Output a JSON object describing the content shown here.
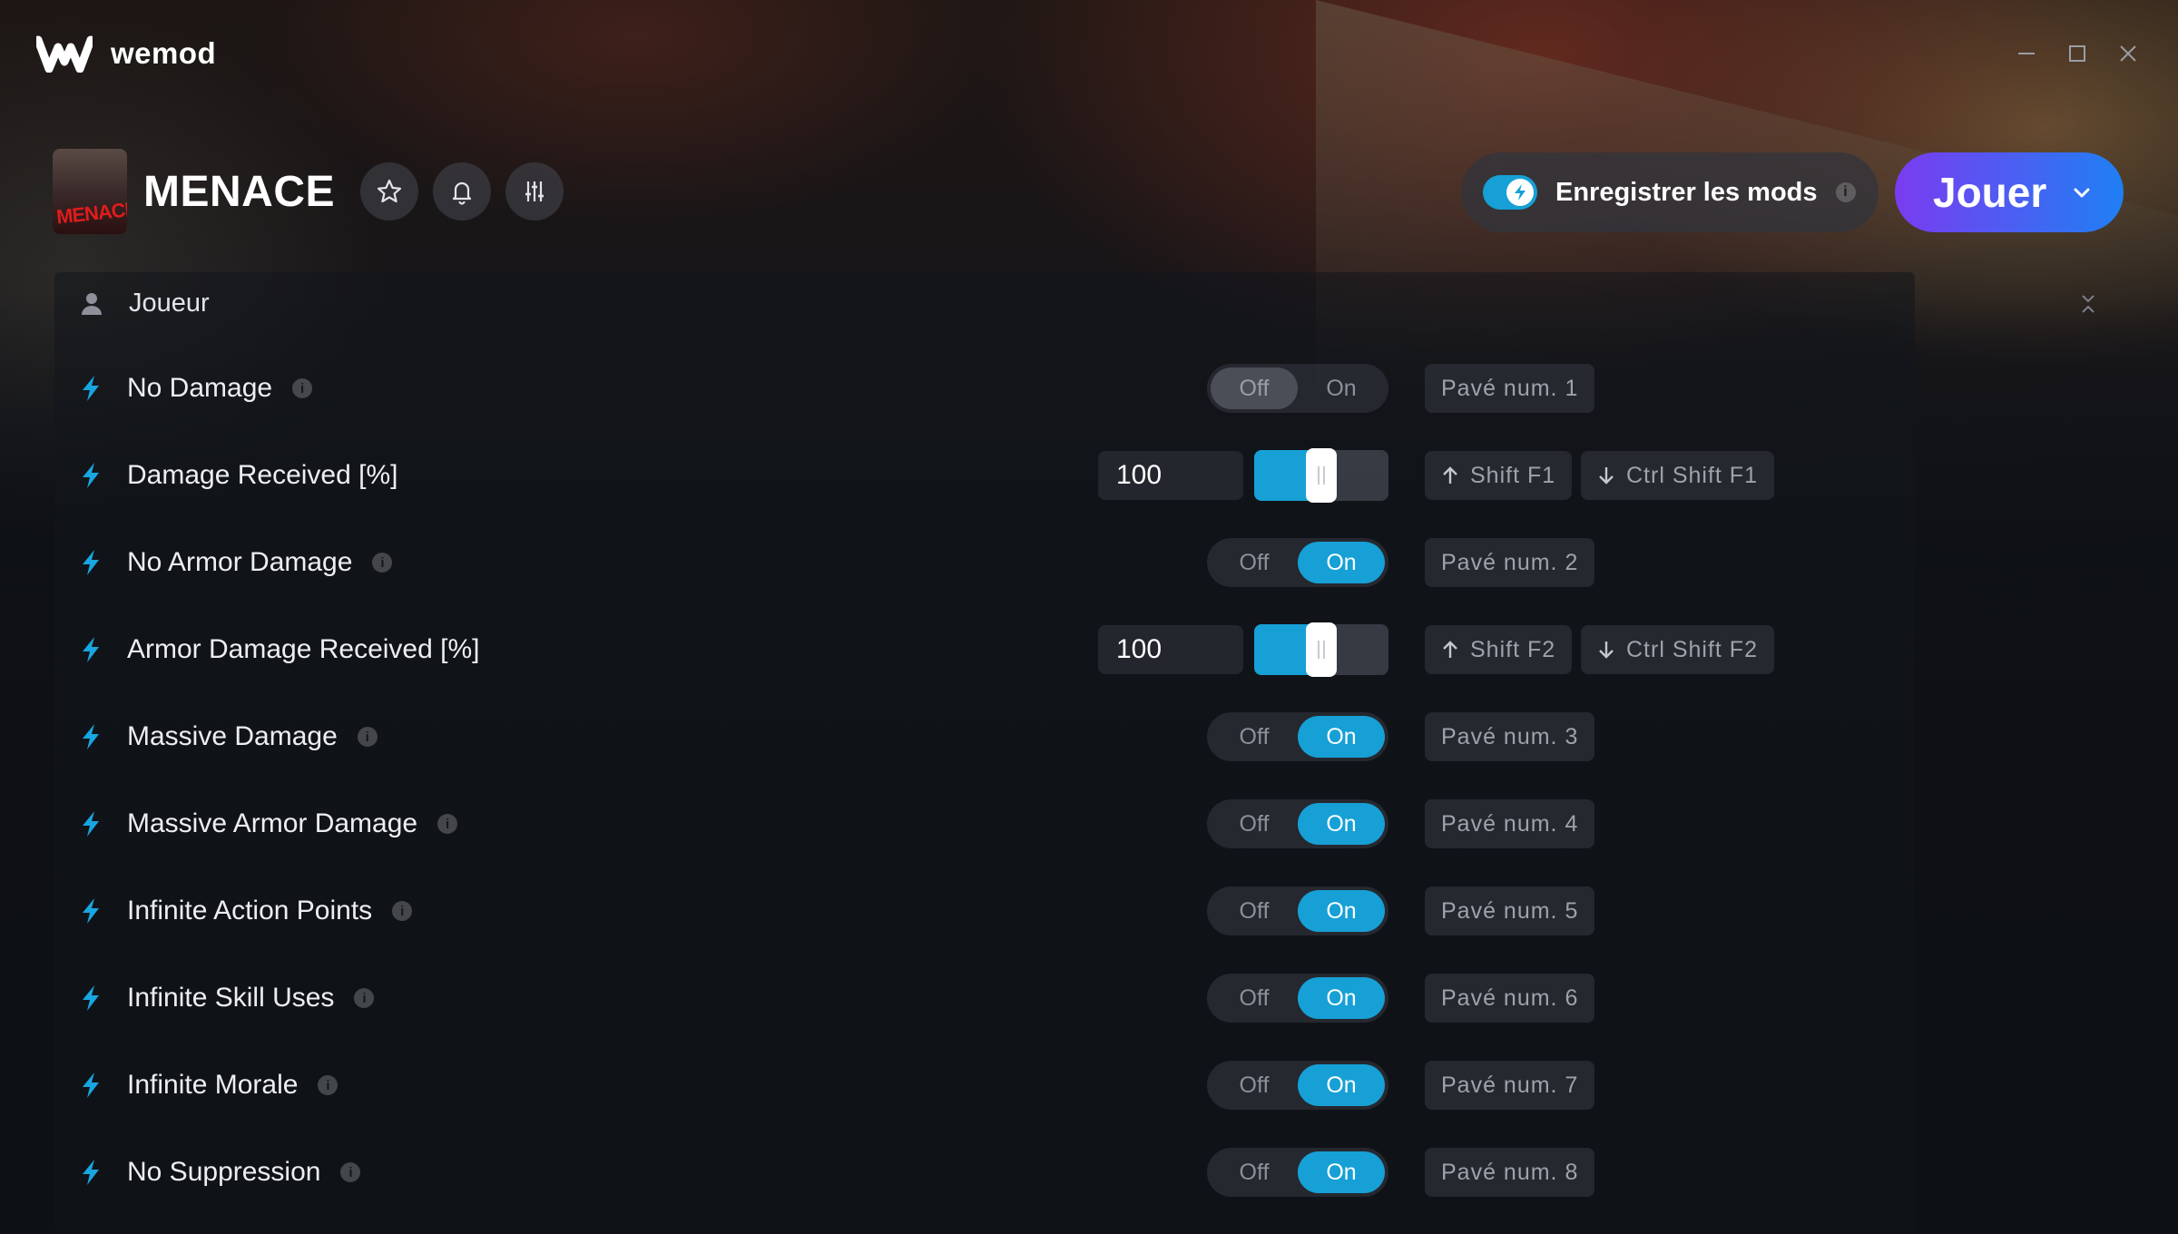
{
  "app": {
    "name": "wemod"
  },
  "game": {
    "title": "MENACE",
    "cover_text": "MENACE"
  },
  "header": {
    "save_mods_label": "Enregistrer les mods",
    "save_mods_info": "i",
    "play_label": "Jouer"
  },
  "section": {
    "title": "Joueur"
  },
  "toggle_labels": {
    "off": "Off",
    "on": "On"
  },
  "mods": [
    {
      "label": "No Damage",
      "info": "i",
      "type": "toggle",
      "state": "off",
      "hotkeys": [
        "Pavé num. 1"
      ]
    },
    {
      "label": "Damage Received [%]",
      "type": "slider",
      "value": "100",
      "level_percent": 50,
      "hotkeys": [
        "Shift F1",
        "Ctrl Shift F1"
      ]
    },
    {
      "label": "No Armor Damage",
      "info": "i",
      "type": "toggle",
      "state": "on",
      "hotkeys": [
        "Pavé num. 2"
      ]
    },
    {
      "label": "Armor Damage Received [%]",
      "type": "slider",
      "value": "100",
      "level_percent": 50,
      "hotkeys": [
        "Shift F2",
        "Ctrl Shift F2"
      ]
    },
    {
      "label": "Massive Damage",
      "info": "i",
      "type": "toggle",
      "state": "on",
      "hotkeys": [
        "Pavé num. 3"
      ]
    },
    {
      "label": "Massive Armor Damage",
      "info": "i",
      "type": "toggle",
      "state": "on",
      "hotkeys": [
        "Pavé num. 4"
      ]
    },
    {
      "label": "Infinite Action Points",
      "info": "i",
      "type": "toggle",
      "state": "on",
      "hotkeys": [
        "Pavé num. 5"
      ]
    },
    {
      "label": "Infinite Skill Uses",
      "info": "i",
      "type": "toggle",
      "state": "on",
      "hotkeys": [
        "Pavé num. 6"
      ]
    },
    {
      "label": "Infinite Morale",
      "info": "i",
      "type": "toggle",
      "state": "on",
      "hotkeys": [
        "Pavé num. 7"
      ]
    },
    {
      "label": "No Suppression",
      "info": "i",
      "type": "toggle",
      "state": "on",
      "hotkeys": [
        "Pavé num. 8"
      ]
    }
  ],
  "colors": {
    "accent": "#16a0d6",
    "play_gradient_start": "#7a3cf0",
    "play_gradient_end": "#1f7ff4",
    "background": "#101217"
  },
  "icons": {
    "favorite": "star-icon",
    "notifications": "bell-icon",
    "settings": "sliders-icon",
    "mod": "bolt-icon",
    "section": "person-icon"
  }
}
